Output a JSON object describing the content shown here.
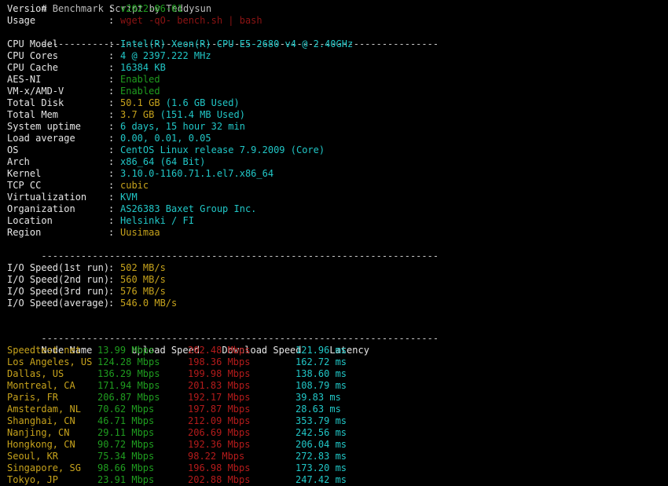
{
  "terminal": {
    "title_line": "# Benchmark Script by Teddysun",
    "separator": "----------------------------------------------------------------------",
    "prompt_labels": {
      "colon": ":"
    }
  },
  "script_info": [
    {
      "label": "Version",
      "value": "v2022-06-01",
      "color": "green"
    },
    {
      "label": "Usage",
      "value": "wget -qO- bench.sh | bash",
      "color": "dred"
    }
  ],
  "system_info": [
    {
      "label": "CPU Model",
      "value": "Intel(R) Xeon(R) CPU E5-2680 v4 @ 2.40GHz",
      "color": "cyan"
    },
    {
      "label": "CPU Cores",
      "value": "4 @ 2397.222 MHz",
      "color": "cyan"
    },
    {
      "label": "CPU Cache",
      "value": "16384 KB",
      "color": "cyan"
    },
    {
      "label": "AES-NI",
      "value": "Enabled",
      "color": "green"
    },
    {
      "label": "VM-x/AMD-V",
      "value": "Enabled",
      "color": "green"
    },
    {
      "label": "Total Disk",
      "value": "50.1 GB",
      "extra": " (1.6 GB Used)",
      "color": "yellow"
    },
    {
      "label": "Total Mem",
      "value": "3.7 GB",
      "extra": " (151.4 MB Used)",
      "color": "yellow"
    },
    {
      "label": "System uptime",
      "value": "6 days, 15 hour 32 min",
      "color": "cyan"
    },
    {
      "label": "Load average",
      "value": "0.00, 0.01, 0.05",
      "color": "cyan"
    },
    {
      "label": "OS",
      "value": "CentOS Linux release 7.9.2009 (Core)",
      "color": "cyan"
    },
    {
      "label": "Arch",
      "value": "x86_64 (64 Bit)",
      "color": "cyan"
    },
    {
      "label": "Kernel",
      "value": "3.10.0-1160.71.1.el7.x86_64",
      "color": "cyan"
    },
    {
      "label": "TCP CC",
      "value": "cubic",
      "color": "yellow"
    },
    {
      "label": "Virtualization",
      "value": "KVM",
      "color": "cyan"
    },
    {
      "label": "Organization",
      "value": "AS26383 Baxet Group Inc.",
      "color": "cyan"
    },
    {
      "label": "Location",
      "value": "Helsinki / FI",
      "color": "cyan"
    },
    {
      "label": "Region",
      "value": "Uusimaa",
      "color": "yellow"
    }
  ],
  "io_speed": [
    {
      "label": "I/O Speed(1st run)",
      "value": "502 MB/s",
      "color": "yellow"
    },
    {
      "label": "I/O Speed(2nd run)",
      "value": "560 MB/s",
      "color": "yellow"
    },
    {
      "label": "I/O Speed(3rd run)",
      "value": "576 MB/s",
      "color": "yellow"
    },
    {
      "label": "I/O Speed(average)",
      "value": "546.0 MB/s",
      "color": "yellow"
    }
  ],
  "speedtest": {
    "headers": {
      "node": "Node Name",
      "upload": "Upload Speed",
      "download": "Download Speed",
      "latency": "Latency"
    },
    "rows": [
      {
        "node": "Speedtest.net",
        "upload": "13.99 Mbps",
        "download": "202.48 Mbps",
        "latency": "121.96 ms"
      },
      {
        "node": "Los Angeles, US",
        "upload": "124.28 Mbps",
        "download": "198.36 Mbps",
        "latency": "162.72 ms"
      },
      {
        "node": "Dallas, US",
        "upload": "136.29 Mbps",
        "download": "199.98 Mbps",
        "latency": "138.60 ms"
      },
      {
        "node": "Montreal, CA",
        "upload": "171.94 Mbps",
        "download": "201.83 Mbps",
        "latency": "108.79 ms"
      },
      {
        "node": "Paris, FR",
        "upload": "206.87 Mbps",
        "download": "192.17 Mbps",
        "latency": "39.83 ms"
      },
      {
        "node": "Amsterdam, NL",
        "upload": "70.62 Mbps",
        "download": "197.87 Mbps",
        "latency": "28.63 ms"
      },
      {
        "node": "Shanghai, CN",
        "upload": "46.71 Mbps",
        "download": "212.09 Mbps",
        "latency": "353.79 ms"
      },
      {
        "node": "Nanjing, CN",
        "upload": "29.11 Mbps",
        "download": "206.69 Mbps",
        "latency": "242.56 ms"
      },
      {
        "node": "Hongkong, CN",
        "upload": "90.72 Mbps",
        "download": "192.36 Mbps",
        "latency": "206.04 ms"
      },
      {
        "node": "Seoul, KR",
        "upload": "75.34 Mbps",
        "download": "98.22 Mbps",
        "latency": "272.83 ms"
      },
      {
        "node": "Singapore, SG",
        "upload": "98.66 Mbps",
        "download": "196.98 Mbps",
        "latency": "173.20 ms"
      },
      {
        "node": "Tokyo, JP",
        "upload": "23.91 Mbps",
        "download": "202.88 Mbps",
        "latency": "247.42 ms"
      }
    ]
  },
  "colors": {
    "background": "#000000",
    "label": "#e6e6e6",
    "cyan": "#21c7c7",
    "green": "#1f9d1f",
    "yellow": "#c7a31c",
    "red": "#b41b1b",
    "dark_red": "#8d1414",
    "separator": "#c9c9c9"
  }
}
